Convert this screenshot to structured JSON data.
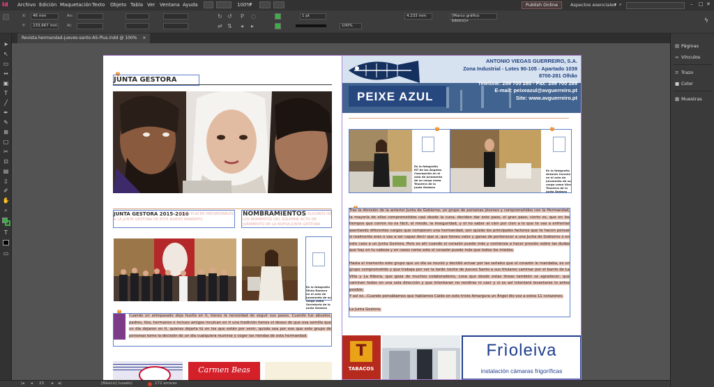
{
  "app": {
    "logo": "Id",
    "menu": [
      "Archivo",
      "Edición",
      "Maquetación",
      "Texto",
      "Objeto",
      "Tabla",
      "Ver",
      "Ventana",
      "Ayuda"
    ],
    "zoom": "100%",
    "publish_label": "Publish Online",
    "workspace_label": "Aspectos esenciales"
  },
  "control": {
    "x_label": "X:",
    "x_value": "46 mm",
    "y_label": "Y:",
    "y_value": "233,667 mm",
    "w_label": "An:",
    "h_label": "Al:",
    "stroke_weight": "1 pt",
    "dimension": "4,233 mm",
    "opacity": "100%",
    "object_style": "[Marco gráfico básico]+"
  },
  "doc_tab": {
    "title": "Revista-hermandad-jueves-santo-AS-Plus.indd @ 100%",
    "close": "×"
  },
  "panels": {
    "items": [
      {
        "icon": "▤",
        "label": "Páginas"
      },
      {
        "icon": "∞",
        "label": "Vínculos"
      },
      {
        "icon": "≡",
        "label": "Trazo"
      },
      {
        "icon": "■",
        "label": "Color"
      },
      {
        "icon": "▦",
        "label": "Muestras"
      }
    ]
  },
  "status": {
    "page": "23",
    "style": "[Básico] (usado)",
    "errors": "172 errores"
  },
  "left_page": {
    "title": "JUNTA GESTORA",
    "section1_title": "JUNTA GESTORA 2015-2016",
    "section1_sub_a": "ES UN PLACER PRESENTARLES",
    "section1_sub_b": "A LA JUNTA GESTORA DE ESTE NUEVO MANDATO.",
    "section2_title": "NOMBRAMIENTOS",
    "section2_sub_a": "ALGUNOS DE",
    "section2_sub_b": "LOS MOMENTOS DEL SOLEMNE ACTO DE JURAMENTO DE LA NUEVA JUNTA GESTORA",
    "caption_secretaria": "En la fotografía Silvia Romero en el acto de juramento de su cargo como Secretaria de la Junta Gestora",
    "intro_text": "Cuando un antepasado deja huella en ti, tienes la necesidad de seguir sus pasos. Cuando tus abuelos, padres, tíos, hermanos o incluso amigos inculcan en ti una tradición tienes el deseo de que esa semilla que un día dejaron en ti, quieras dejarla tú en los que están por venir, quizás sea por eso que este grupo de personas tome la decisión de un día cualquiera reunirse y coger las riendas de esta hermandad.",
    "ads": [
      "Carmen Beas"
    ]
  },
  "right_page": {
    "banner": {
      "company": "ANTONIO VIEGAS GUERREIRO, S.A.",
      "address": "Zona Industrial - Lotes 90-105 - Apartado 1039",
      "city": "8700-281 Olhão",
      "phone": "Telefone: 289 700 280 - Fax: 289 700 289",
      "email": "E-mail: peixeazul@avguerreiro.pt",
      "site": "Site: www.avguerreiro.pt",
      "brand": "PEIXE AZUL"
    },
    "caption_tesorera": "En la fotografía Mª de los Ángeles Concepción en el acto de juramento de su cargo como Tesorera de la Junta Gestora",
    "caption_vicetesorero": "En la fotografía Antonio Caravia en el acto de juramento de su cargo como Vice Tesorero de la Junta Gestora",
    "paragraphs": [
      "Tras la dimisión de la anterior Junta de Gobierno, un grupo de personas jóvenes y comprometidos con la Hermandad, la mayoría de ellos comprometidos casi desde la cuna, deciden dar este paso, el gran paso, cierto es, que en los tiempos que corren no es fácil, el miedo, la inseguridad, y el no saber al cien por cien a lo que te vas a enfrentar asentando diferentes cargos que componen una hermandad, son quizás los principales factores que te hacen pensar si realmente eres o vas a ser capaz decir que sí, que tienes valor y ganas de pertenecer a una Junta de Gobierno o en este caso a un Junta Gestora. Pero es ahí cuando el corazón puede más y comienza a hacer presión sobre las dudas que hay en tu cabeza y en casos como este el corazón puede más que todos los miedos.",
      "Hasta el momento este grupo que un día se reunió y decidió actuar por las señales que el corazón le mandaba, es un grupo comprometido y que trabaja por ver la tarde noche de Jueves Santo a sus titulares caminar por el barrio de La Villa y La Ribera, que goza de muchos colaboradores, cosa que desde estas líneas también se agradecer, que caminan todos en una sola dirección y que intentaran no rendirse ni caer y si es así intentará levantarse lo antes posible.",
      "Y así es…Cuando pensábamos que habíamos Caído en este triste Amargura un Ángel dio voz a estos 11 corazones.",
      "La Junta Gestora."
    ],
    "ads": {
      "tabacos": "TABACOS",
      "frioleiva": "Frìoleiva",
      "frioleiva_sub": "instalación cámaras frigoríficas"
    }
  }
}
